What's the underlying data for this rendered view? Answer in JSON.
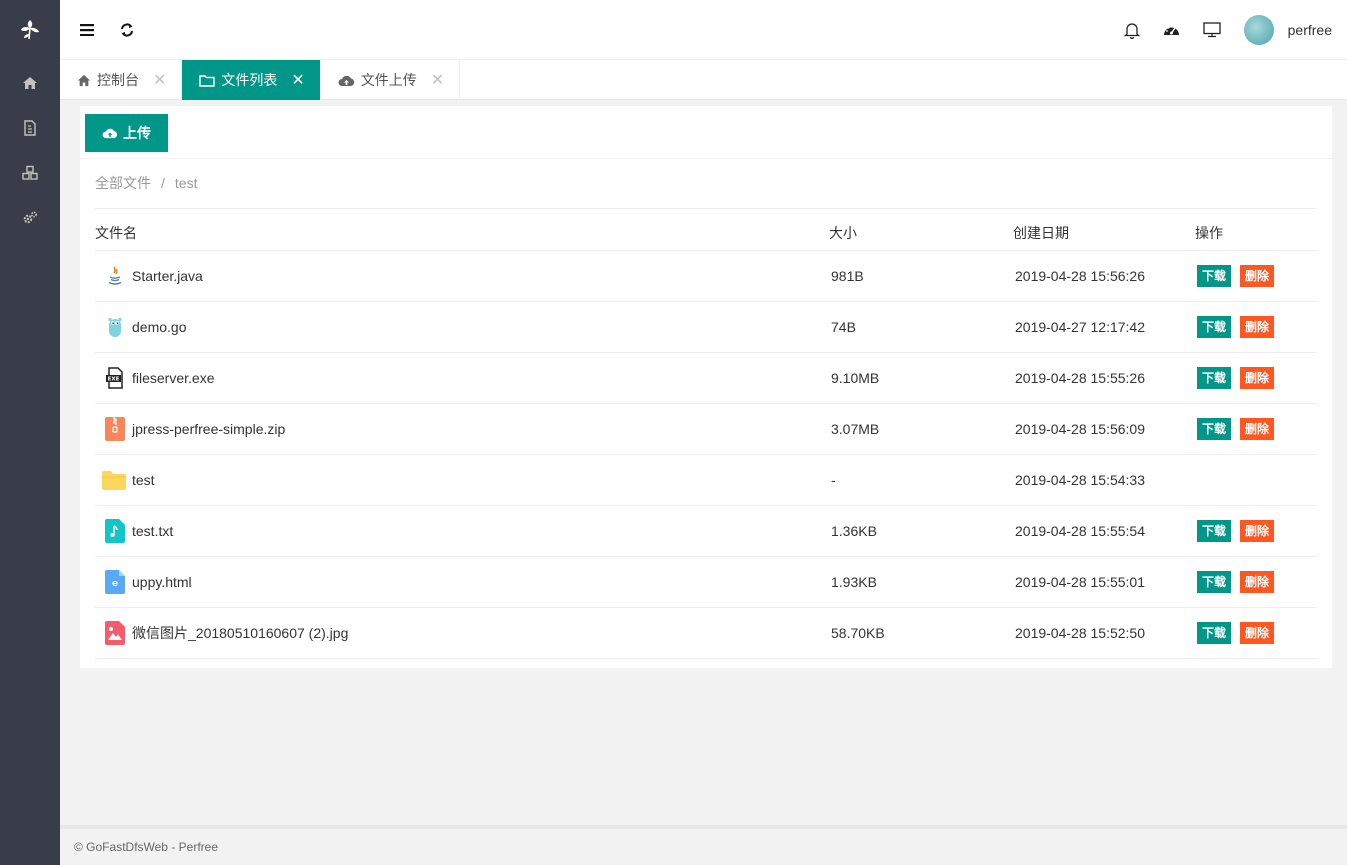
{
  "header": {
    "username": "perfree"
  },
  "tabs": [
    {
      "label": "控制台",
      "icon": "home-icon",
      "active": false
    },
    {
      "label": "文件列表",
      "icon": "folder-icon",
      "active": true
    },
    {
      "label": "文件上传",
      "icon": "cloud-upload-icon",
      "active": false
    }
  ],
  "toolbar": {
    "upload_label": "上传"
  },
  "breadcrumb": {
    "root": "全部文件",
    "separator": "/",
    "current": "test"
  },
  "table": {
    "headers": {
      "name": "文件名",
      "size": "大小",
      "date": "创建日期",
      "ops": "操作"
    },
    "download_label": "下载",
    "delete_label": "删除",
    "rows": [
      {
        "name": "Starter.java",
        "size": "981B",
        "date": "2019-04-28 15:56:26",
        "icon": "java-file-icon"
      },
      {
        "name": "demo.go",
        "size": "74B",
        "date": "2019-04-27 12:17:42",
        "icon": "go-file-icon"
      },
      {
        "name": "fileserver.exe",
        "size": "9.10MB",
        "date": "2019-04-28 15:55:26",
        "icon": "exe-file-icon"
      },
      {
        "name": "jpress-perfree-simple.zip",
        "size": "3.07MB",
        "date": "2019-04-28 15:56:09",
        "icon": "zip-file-icon"
      },
      {
        "name": "test",
        "size": "-",
        "date": "2019-04-28 15:54:33",
        "icon": "folder-icon"
      },
      {
        "name": "test.txt",
        "size": "1.36KB",
        "date": "2019-04-28 15:55:54",
        "icon": "text-file-icon"
      },
      {
        "name": "uppy.html",
        "size": "1.93KB",
        "date": "2019-04-28 15:55:01",
        "icon": "html-file-icon"
      },
      {
        "name": "微信图片_20180510160607 (2).jpg",
        "size": "58.70KB",
        "date": "2019-04-28 15:52:50",
        "icon": "image-file-icon"
      }
    ]
  },
  "footer": {
    "text": "© GoFastDfsWeb - Perfree"
  },
  "colors": {
    "sidebar": "#393d49",
    "primary": "#009688",
    "danger": "#ff5722"
  }
}
